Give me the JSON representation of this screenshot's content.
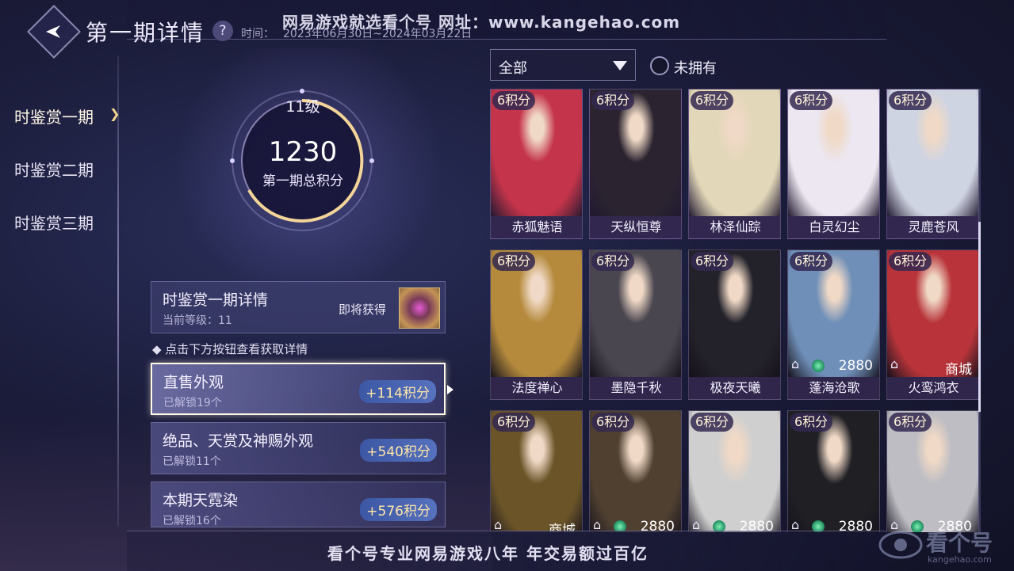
{
  "header": {
    "title": "第一期详情",
    "help_icon": "?",
    "time_label": "时间：",
    "time_value": "2023年06月30日~2024年03月22日",
    "banner_text": "网易游戏就选看个号  网址：www.kangehao.com"
  },
  "menu": {
    "items": [
      {
        "label": "时鉴赏一期",
        "active": true
      },
      {
        "label": "时鉴赏二期",
        "active": false
      },
      {
        "label": "时鉴赏三期",
        "active": false
      }
    ]
  },
  "score": {
    "level": "11级",
    "value": "1230",
    "label": "第一期总积分"
  },
  "detail": {
    "title": "时鉴赏一期详情",
    "sub": "当前等级：11",
    "soon": "即将获得"
  },
  "hint": "◆ 点击下方按钮查看获取详情",
  "categories": [
    {
      "title": "直售外观",
      "sub": "已解锁19个",
      "points": "+114积分",
      "selected": true
    },
    {
      "title": "绝品、天赏及神赐外观",
      "sub": "已解锁11个",
      "points": "+540积分",
      "selected": false
    },
    {
      "title": "本期天霓染",
      "sub": "已解锁16个",
      "points": "+576积分",
      "selected": false
    }
  ],
  "filter": {
    "selected": "全部",
    "unowned_label": "未拥有"
  },
  "cards": [
    {
      "points": "6积分",
      "name": "赤狐魅语",
      "color": "#c4344a",
      "footer": ""
    },
    {
      "points": "6积分",
      "name": "天纵恒尊",
      "color": "#2b2430",
      "footer": ""
    },
    {
      "points": "6积分",
      "name": "林泽仙踪",
      "color": "#e2d7b8",
      "footer": ""
    },
    {
      "points": "6积分",
      "name": "白灵幻尘",
      "color": "#ece7f0",
      "footer": ""
    },
    {
      "points": "6积分",
      "name": "灵鹿苍风",
      "color": "#cfd4e2",
      "footer": ""
    },
    {
      "points": "6积分",
      "name": "法度禅心",
      "color": "#b58a3c",
      "footer": ""
    },
    {
      "points": "6积分",
      "name": "墨隐千秋",
      "color": "#4a4650",
      "footer": ""
    },
    {
      "points": "6积分",
      "name": "极夜天曦",
      "color": "#23212a",
      "footer": ""
    },
    {
      "points": "6积分",
      "name": "蓬海沧歌",
      "color": "#6f8fb8",
      "footer": "2880"
    },
    {
      "points": "6积分",
      "name": "火鸾鸿衣",
      "color": "#b8343a",
      "footer": "商城"
    },
    {
      "points": "6积分",
      "name": "",
      "color": "#6a5428",
      "footer": "商城"
    },
    {
      "points": "6积分",
      "name": "",
      "color": "#4f4030",
      "footer": "2880"
    },
    {
      "points": "6积分",
      "name": "",
      "color": "#cfcfcf",
      "footer": "2880"
    },
    {
      "points": "6积分",
      "name": "",
      "color": "#1f1f24",
      "footer": "2880"
    },
    {
      "points": "6积分",
      "name": "",
      "color": "#bdbdc3",
      "footer": "2880"
    }
  ],
  "footer": {
    "banner_text": "看个号专业网易游戏八年  年交易额过百亿",
    "watermark": "看个号",
    "watermark_sub": "kangehao.com"
  }
}
